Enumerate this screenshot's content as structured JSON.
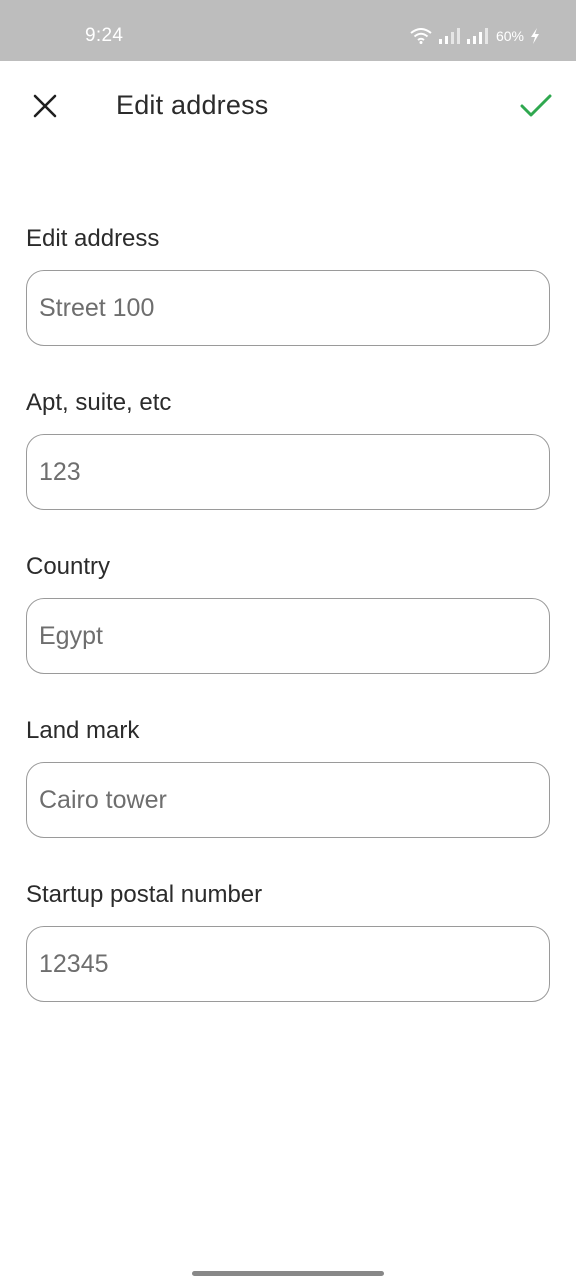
{
  "status_bar": {
    "time": "9:24",
    "battery": "60%",
    "icons": [
      "wifi-icon",
      "signal-icon",
      "signal-icon",
      "battery-charging-icon"
    ]
  },
  "app_bar": {
    "title": "Edit address",
    "close_icon": "close-icon",
    "confirm_icon": "check-icon",
    "confirm_color": "#2fa84f"
  },
  "form": {
    "fields": [
      {
        "label": "Edit address",
        "value": "Street 100"
      },
      {
        "label": "Apt, suite, etc",
        "value": "123"
      },
      {
        "label": "Country",
        "value": "Egypt"
      },
      {
        "label": "Land mark",
        "value": "Cairo tower"
      },
      {
        "label": "Startup postal number",
        "value": "12345"
      }
    ]
  }
}
